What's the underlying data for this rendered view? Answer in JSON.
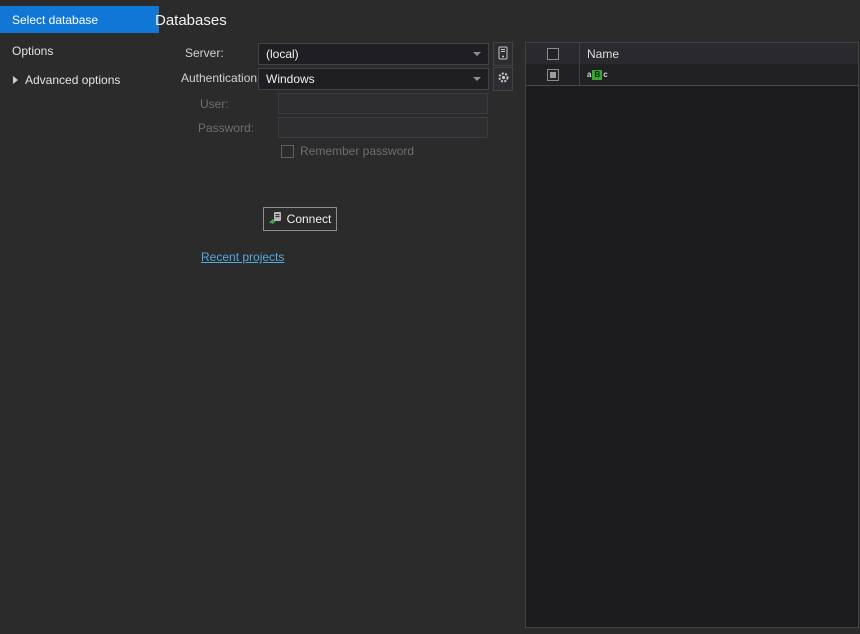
{
  "sidebar": {
    "select_database": "Select database",
    "options": "Options",
    "advanced_options": "Advanced options"
  },
  "main": {
    "title": "Databases",
    "server_label": "Server:",
    "server_value": "(local)",
    "auth_label": "Authentication:",
    "auth_value": "Windows",
    "user_label": "User:",
    "user_value": "",
    "password_label": "Password:",
    "password_value": "",
    "remember_label": "Remember password",
    "connect_label": "Connect",
    "recent_projects": "Recent projects"
  },
  "grid": {
    "name_column": "Name",
    "rows": [
      {
        "checked": true,
        "letters": [
          "a",
          "B",
          "c"
        ],
        "name": ""
      }
    ]
  },
  "colors": {
    "accent": "#1177d7",
    "link": "#53a9e0"
  }
}
